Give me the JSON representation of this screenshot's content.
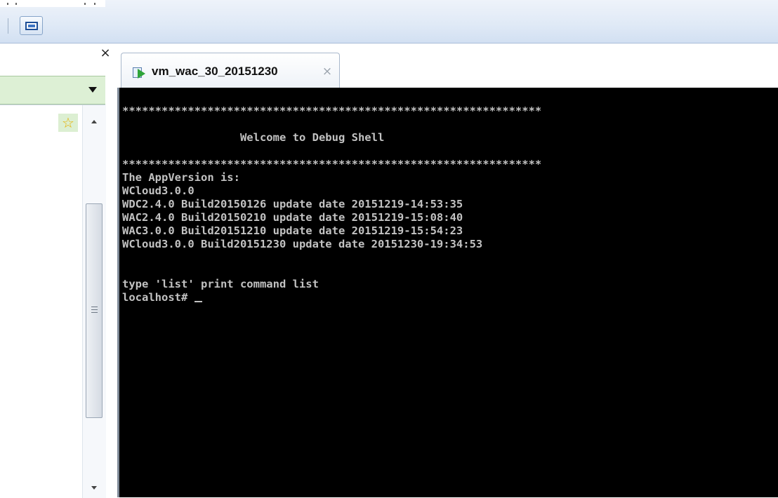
{
  "toolbar": {
    "icons": [
      "console-view-icon"
    ]
  },
  "sidebar": {
    "close_glyph": "×",
    "icons": [
      "chevron-down-icon",
      "star-icon",
      "scroll-up-icon",
      "scroll-down-icon"
    ]
  },
  "tab": {
    "title": "vm_wac_30_20151230",
    "close_glyph": "×",
    "icon": "vm-running-icon"
  },
  "console": {
    "lines": [
      "****************************************************************",
      "",
      "                  Welcome to Debug Shell",
      "",
      "****************************************************************",
      "The AppVersion is:",
      "WCloud3.0.0",
      "WDC2.4.0 Build20150126 update date 20151219-14:53:35",
      "WAC2.4.0 Build20150210 update date 20151219-15:08:40",
      "WAC3.0.0 Build20151210 update date 20151219-15:54:23",
      "WCloud3.0.0 Build20151230 update date 20151230-19:34:53",
      "",
      "",
      "type 'list' print command list"
    ],
    "prompt": "localhost# "
  },
  "colors": {
    "console_bg": "#000000",
    "console_fg": "#c2c2c2",
    "sidebar_highlight": "#ddf0d5",
    "toolbar_bg": "#dfe9f6"
  }
}
